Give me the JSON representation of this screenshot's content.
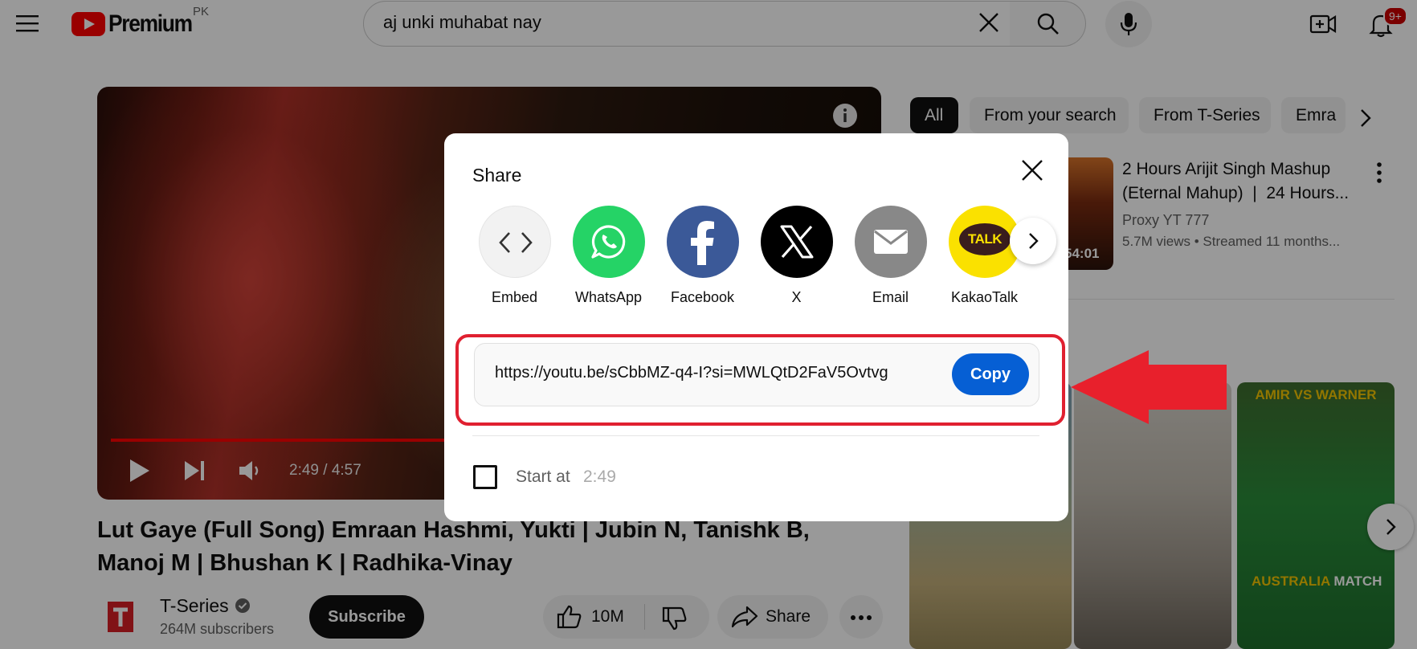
{
  "header": {
    "brand": "Premium",
    "country": "PK",
    "search_query": "aj unki muhabat nay",
    "notifications_badge": "9+",
    "icons": [
      "menu-icon",
      "youtube-logo-icon",
      "clear-icon",
      "search-icon",
      "mic-icon",
      "create-icon",
      "bell-icon"
    ]
  },
  "player": {
    "time": "2:49 / 4:57",
    "progress_fraction": 0.593
  },
  "video": {
    "title": "Lut Gaye (Full Song) Emraan Hashmi, Yukti | Jubin N, Tanishk B, Manoj M | Bhushan K | Radhika-Vinay",
    "channel": "T-Series",
    "subscribers": "264M subscribers",
    "subscribe_label": "Subscribe",
    "likes": "10M",
    "share_label": "Share"
  },
  "sidebar": {
    "chips": [
      "All",
      "From your search",
      "From T-Series",
      "Emra"
    ],
    "recommendation": {
      "title_line1": "2 Hours Arijit Singh Mashup",
      "title_line2": "(Eternal Mahup)  |  24 Hours...",
      "channel": "Proxy YT 777",
      "meta": "5.7M views  • Streamed 11 months...",
      "duration": "54:01"
    },
    "short3_top": "AMIR VS WARNER",
    "short3_bottom_hl": "AUSTRALIA",
    "short3_bottom_rest": " MATCH"
  },
  "share_dialog": {
    "title": "Share",
    "targets": [
      {
        "label": "Embed",
        "color": "#f2f2f2"
      },
      {
        "label": "WhatsApp",
        "color": "#25d366"
      },
      {
        "label": "Facebook",
        "color": "#3b5998"
      },
      {
        "label": "X",
        "color": "#000000"
      },
      {
        "label": "Email",
        "color": "#888888"
      },
      {
        "label": "KakaoTalk",
        "color": "#fae100"
      }
    ],
    "kakao_text": "TALK",
    "url": "https://youtu.be/sCbbMZ-q4-I?si=MWLQtD2FaV5Ovtvg",
    "copy_label": "Copy",
    "start_at_label": "Start at",
    "start_at_time": "2:49"
  },
  "colors": {
    "accent_blue": "#065fd4",
    "youtube_red": "#ff0000",
    "annotation_red": "#e02030"
  }
}
